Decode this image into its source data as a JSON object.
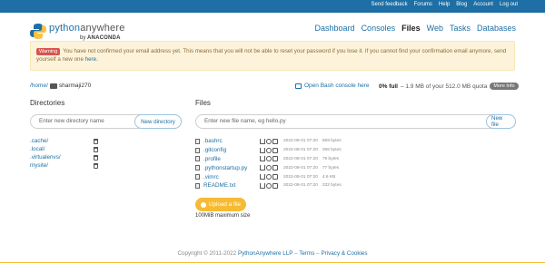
{
  "topbar": {
    "links": [
      "Send feedback",
      "Forums",
      "Help",
      "Blog",
      "Account",
      "Log out"
    ]
  },
  "logo": {
    "title_a": "python",
    "title_b": "anywhere",
    "by": "by",
    "brand": "ANACONDA"
  },
  "nav": {
    "items": [
      {
        "label": "Dashboard",
        "active": false
      },
      {
        "label": "Consoles",
        "active": false
      },
      {
        "label": "Files",
        "active": true
      },
      {
        "label": "Web",
        "active": false
      },
      {
        "label": "Tasks",
        "active": false
      },
      {
        "label": "Databases",
        "active": false
      }
    ]
  },
  "warning": {
    "badge": "Warning",
    "text": "You have not confirmed your email address yet. This means that you will not be able to reset your password if you lose it. If you cannot find your confirmation email anymore, send yourself a new one ",
    "link": "here",
    "end": "."
  },
  "breadcrumb": {
    "home": "/home/",
    "user": "sharmaji270"
  },
  "bash": {
    "label": "Open Bash console here"
  },
  "quota": {
    "full": "0% full",
    "detail": "– 1.9 MB of your 512.0 MB quota",
    "more": "More Info"
  },
  "directories": {
    "title": "Directories",
    "placeholder": "Enter new directory name",
    "button": "New directory",
    "items": [
      ".cache/",
      ".local/",
      ".virtualenvs/",
      "mysite/"
    ]
  },
  "files": {
    "title": "Files",
    "placeholder": "Enter new file name, eg hello.py",
    "button": "New file",
    "items": [
      {
        "name": ".bashrc",
        "date": "2022-08-01 07:20",
        "size": "559 bytes"
      },
      {
        "name": ".gitconfig",
        "date": "2022-08-01 07:20",
        "size": "266 bytes"
      },
      {
        "name": ".profile",
        "date": "2022-08-01 07:20",
        "size": "79 bytes"
      },
      {
        "name": ".pythonstartup.py",
        "date": "2022-08-01 07:20",
        "size": "77 bytes"
      },
      {
        "name": ".vimrc",
        "date": "2022-08-01 07:20",
        "size": "4.6 KB"
      },
      {
        "name": "README.txt",
        "date": "2022-08-01 07:20",
        "size": "232 bytes"
      }
    ]
  },
  "upload": {
    "label": "Upload a file",
    "note": "100MiB maximum size"
  },
  "footer": {
    "copy": "Copyright © 2011-2022 ",
    "company": "PythonAnywhere LLP",
    "dash1": " – ",
    "terms": "Terms",
    "dash2": " – ",
    "privacy": "Privacy & Cookies"
  }
}
